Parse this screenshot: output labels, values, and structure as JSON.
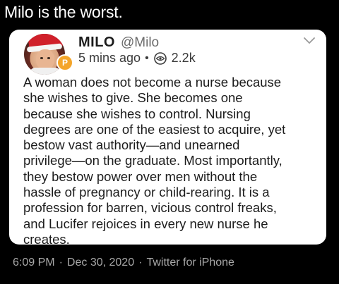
{
  "post": {
    "text": "Milo is the worst."
  },
  "quoted": {
    "name": "MILO",
    "handle": "@Milo",
    "time": "5 mins ago",
    "separator": "•",
    "views": "2.2k",
    "badge_letter": "P",
    "body": "A woman does not become a nurse because\nshe wishes to give. She becomes one\nbecause she wishes to control. Nursing\ndegrees are one of the easiest to acquire, yet\nbestow vast authority—and unearned\nprivilege—on the graduate. Most importantly,\nthey bestow power over men without the\nhassle of pregnancy or child-rearing. It is a\nprofession for barren, vicious control freaks,\nand Lucifer rejoices in every new nurse he\ncreates."
  },
  "footer": {
    "time": "6:09 PM",
    "date": "Dec 30, 2020",
    "client": "Twitter for iPhone",
    "separator": "·"
  },
  "icons": {
    "avatar": "avatar",
    "badge": "badge-icon",
    "views": "eye-circle-icon",
    "menu": "chevron-down-icon"
  },
  "colors": {
    "background": "#000000",
    "card": "#ffffff",
    "badge": "#f4a52a",
    "footer_text": "#a8a8a8"
  }
}
